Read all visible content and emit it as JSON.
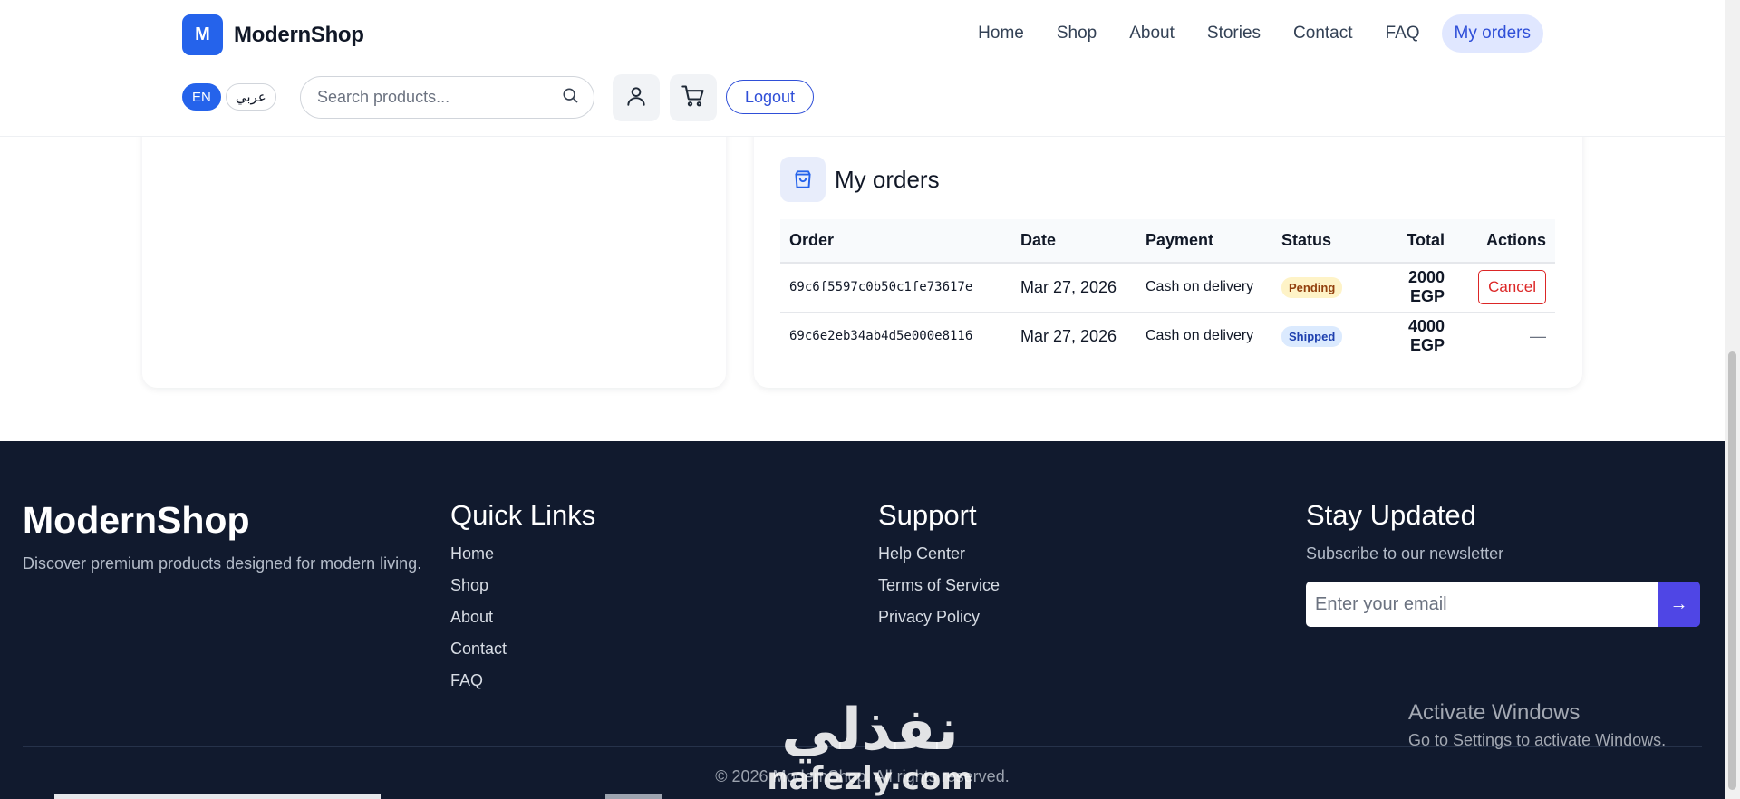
{
  "brand": {
    "logo_letter": "M",
    "name": "ModernShop",
    "accent": "#2563eb"
  },
  "nav": {
    "items": [
      {
        "label": "Home"
      },
      {
        "label": "Shop"
      },
      {
        "label": "About"
      },
      {
        "label": "Stories"
      },
      {
        "label": "Contact"
      },
      {
        "label": "FAQ"
      },
      {
        "label": "My orders",
        "active": true
      }
    ]
  },
  "language": {
    "en": "EN",
    "ar": "عربي",
    "selected": "EN"
  },
  "search": {
    "placeholder": "Search products...",
    "value": ""
  },
  "header_icons": {
    "profile": "user-icon",
    "cart": "cart-icon",
    "search": "search-icon"
  },
  "auth": {
    "logout_label": "Logout"
  },
  "orders": {
    "title": "My orders",
    "icon": "shopping-bag-icon",
    "columns": [
      "Order",
      "Date",
      "Payment",
      "Status",
      "Total",
      "Actions"
    ],
    "rows": [
      {
        "id": "69c6f5597c0b50c1fe73617e",
        "date": "Mar 27, 2026",
        "payment": "Cash on delivery",
        "status": "Pending",
        "total": "2000 EGP",
        "action": "Cancel"
      },
      {
        "id": "69c6e2eb34ab4d5e000e8116",
        "date": "Mar 27, 2026",
        "payment": "Cash on delivery",
        "status": "Shipped",
        "total": "4000 EGP",
        "action": "—"
      }
    ],
    "status_colors": {
      "pending": "#92400e",
      "shipped": "#1e40af",
      "cancel": "#dc2626"
    }
  },
  "footer": {
    "brand": "ModernShop",
    "tagline": "Discover premium products designed for modern living.",
    "quick_links": {
      "title": "Quick Links",
      "items": [
        "Home",
        "Shop",
        "About",
        "Contact",
        "FAQ"
      ]
    },
    "support": {
      "title": "Support",
      "items": [
        "Help Center",
        "Terms of Service",
        "Privacy Policy"
      ]
    },
    "newsletter": {
      "title": "Stay Updated",
      "subtitle": "Subscribe to our newsletter",
      "placeholder": "Enter your email",
      "button": "→"
    },
    "copyright": "© 2026 ModernShop. All rights reserved.",
    "background": "#111a2e"
  },
  "os_overlay": {
    "line1": "Activate Windows",
    "line2": "Go to Settings to activate Windows."
  },
  "watermark": {
    "arabic": "نفذلي",
    "latin": "nafezly.com"
  }
}
